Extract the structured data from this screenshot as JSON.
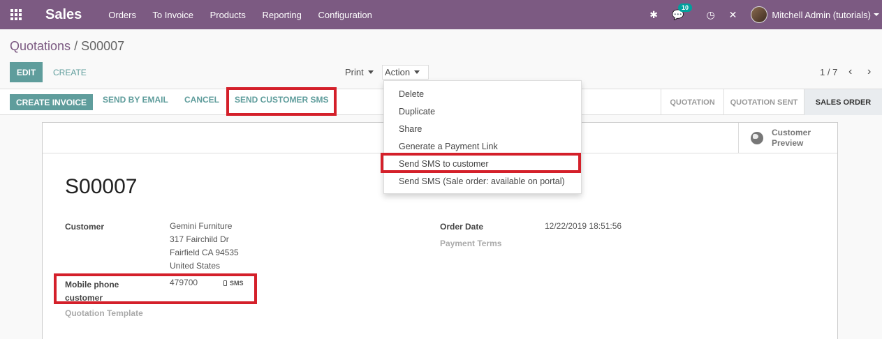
{
  "navbar": {
    "brand": "Sales",
    "menu": [
      "Orders",
      "To Invoice",
      "Products",
      "Reporting",
      "Configuration"
    ],
    "messages_badge": "10",
    "user": "Mitchell Admin (tutorials)"
  },
  "breadcrumb": {
    "parent": "Quotations",
    "separator": "/",
    "current": "S00007"
  },
  "toolbar": {
    "edit": "EDIT",
    "create": "CREATE",
    "print": "Print",
    "action": "Action",
    "pager": "1 / 7"
  },
  "statusbar": {
    "create_invoice": "CREATE INVOICE",
    "send_email": "SEND BY EMAIL",
    "cancel": "CANCEL",
    "send_sms": "SEND CUSTOMER SMS",
    "stages": [
      "QUOTATION",
      "QUOTATION SENT",
      "SALES ORDER"
    ]
  },
  "action_menu": [
    "Delete",
    "Duplicate",
    "Share",
    "Generate a Payment Link",
    "Send SMS to customer",
    "Send SMS (Sale order: available on portal)"
  ],
  "sheet": {
    "preview_line1": "Customer",
    "preview_line2": "Preview",
    "title": "S00007",
    "customer_label": "Customer",
    "customer_name": "Gemini Furniture",
    "address1": "317 Fairchild Dr",
    "address2": "Fairfield CA 94535",
    "address3": "United States",
    "mobile_label1": "Mobile phone",
    "mobile_label2": "customer",
    "mobile_value": "479700",
    "sms_label": "SMS",
    "template_label": "Quotation Template",
    "order_date_label": "Order Date",
    "order_date": "12/22/2019 18:51:56",
    "payment_terms_label": "Payment Terms"
  },
  "colors": {
    "navbar": "#7c5a82",
    "primary": "#5f9d9c",
    "highlight": "#d4202a"
  }
}
